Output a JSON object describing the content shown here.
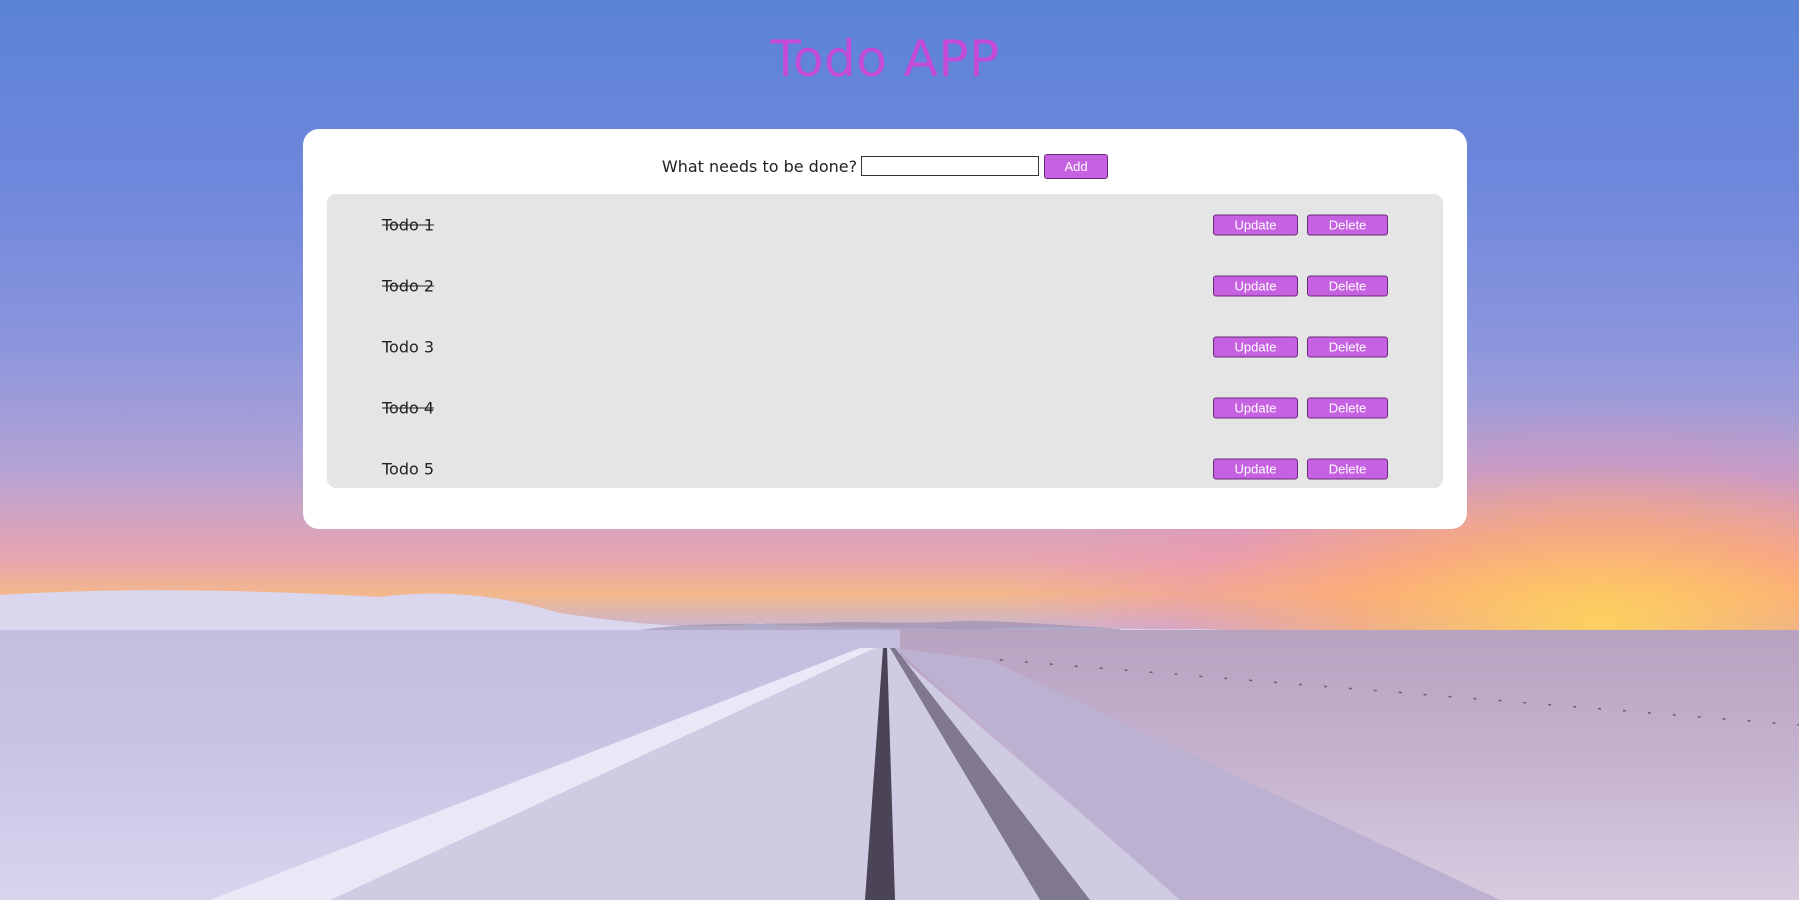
{
  "app": {
    "title": "Todo APP"
  },
  "form": {
    "label": "What needs to be done?",
    "input_value": "",
    "input_placeholder": "",
    "add_label": "Add"
  },
  "todos": [
    {
      "text": "Todo 1",
      "done": true,
      "update_label": "Update",
      "delete_label": "Delete"
    },
    {
      "text": "Todo 2",
      "done": true,
      "update_label": "Update",
      "delete_label": "Delete"
    },
    {
      "text": "Todo 3",
      "done": false,
      "update_label": "Update",
      "delete_label": "Delete"
    },
    {
      "text": "Todo 4",
      "done": true,
      "update_label": "Update",
      "delete_label": "Delete"
    },
    {
      "text": "Todo 5",
      "done": false,
      "update_label": "Update",
      "delete_label": "Delete"
    }
  ],
  "colors": {
    "accent": "#c661e2",
    "title": "#c44ad8",
    "card": "#ffffff",
    "list_bg": "#e5e5e5"
  }
}
